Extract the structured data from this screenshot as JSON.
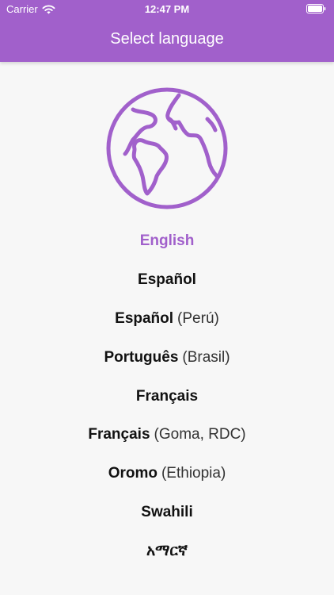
{
  "status_bar": {
    "carrier": "Carrier",
    "time": "12:47 PM"
  },
  "header": {
    "title": "Select language",
    "color": "#a160cb"
  },
  "icons": {
    "globe": "globe-icon",
    "wifi": "wifi-icon",
    "battery": "battery-icon"
  },
  "languages": [
    {
      "name": "English",
      "region": "",
      "selected": true
    },
    {
      "name": "Español",
      "region": "",
      "selected": false
    },
    {
      "name": "Español",
      "region": "(Perú)",
      "selected": false
    },
    {
      "name": "Português",
      "region": "(Brasil)",
      "selected": false
    },
    {
      "name": "Français",
      "region": "",
      "selected": false
    },
    {
      "name": "Français",
      "region": "(Goma, RDC)",
      "selected": false
    },
    {
      "name": "Oromo",
      "region": "(Ethiopia)",
      "selected": false
    },
    {
      "name": "Swahili",
      "region": "",
      "selected": false
    },
    {
      "name": "አማርኛ",
      "region": "",
      "selected": false
    }
  ]
}
